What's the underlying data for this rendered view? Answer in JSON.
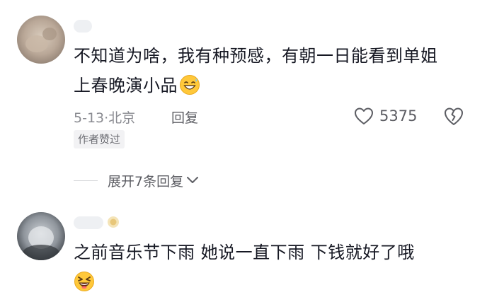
{
  "comments": [
    {
      "username": "",
      "text_lines": [
        "不知道为啥，我有种预感，有朝一日能看到单姐",
        "上春晚演小品"
      ],
      "emoji": "grinning-sweat-emoji",
      "date": "5-13",
      "location": "北京",
      "reply_label": "回复",
      "like_count": "5375",
      "author_badge": "作者赞过",
      "expand_label": "展开7条回复"
    },
    {
      "username": "",
      "text_lines": [
        "之前音乐节下雨   她说一直下雨   下钱就好了哦"
      ],
      "emoji": "laughing-emoji"
    }
  ],
  "colors": {
    "text": "#161823",
    "meta": "#8a8b91",
    "secondary": "#5c5d63",
    "badge_bg": "#f2f2f4",
    "emoji_face": "#ffc83a"
  },
  "icons": {
    "like": "heart-outline-icon",
    "dislike": "broken-heart-icon",
    "expand": "chevron-down-icon"
  }
}
